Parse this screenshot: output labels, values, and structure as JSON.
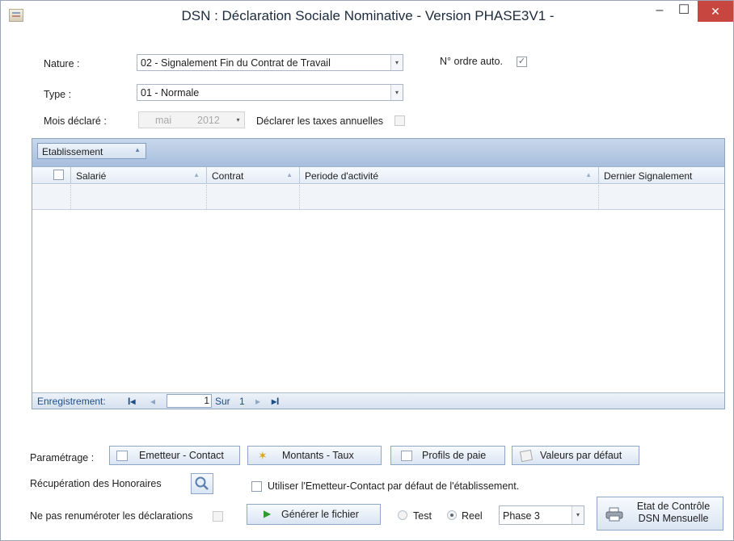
{
  "window": {
    "title": "DSN : Déclaration Sociale Nominative - Version PHASE3V1 -",
    "minimize": "–",
    "maximize": "☐",
    "close": "✕"
  },
  "form": {
    "nature_label": "Nature :",
    "nature_value": "02 - Signalement Fin du Contrat de Travail",
    "ordre_label": "N° ordre auto.",
    "ordre_checked": true,
    "type_label": "Type :",
    "type_value": "01 - Normale",
    "mois_label": "Mois déclaré :",
    "mois_month": "mai",
    "mois_year": "2012",
    "taxes_label": "Déclarer les taxes annuelles"
  },
  "grid": {
    "group_label": "Etablissement",
    "columns": [
      "Salarié",
      "Contrat",
      "Periode d'activité",
      "Dernier Signalement"
    ],
    "nav": {
      "label": "Enregistrement:",
      "first": "I◂",
      "prev": "◂",
      "page": "1",
      "sur": "Sur",
      "total": "1",
      "next": "▸",
      "last": "▸I"
    }
  },
  "parametrage": {
    "label": "Paramétrage :",
    "buttons": [
      "Emetteur - Contact",
      "Montants - Taux",
      "Profils de paie",
      "Valeurs par défaut"
    ]
  },
  "recuperation_label": "Récupération des Honoraires",
  "utiliser_label": "Utiliser l'Emetteur-Contact par défaut de l'établissement.",
  "renumeroter_label": "Ne pas renuméroter les déclarations",
  "generer_label": "Générer le fichier",
  "mode": {
    "test_label": "Test",
    "reel_label": "Reel",
    "selected": "Reel"
  },
  "phase_value": "Phase 3",
  "etat_button": {
    "line1": "Etat de Contrôle",
    "line2": "DSN Mensuelle"
  },
  "colors": {
    "accent": "#a7bedc",
    "close": "#c7463f"
  }
}
